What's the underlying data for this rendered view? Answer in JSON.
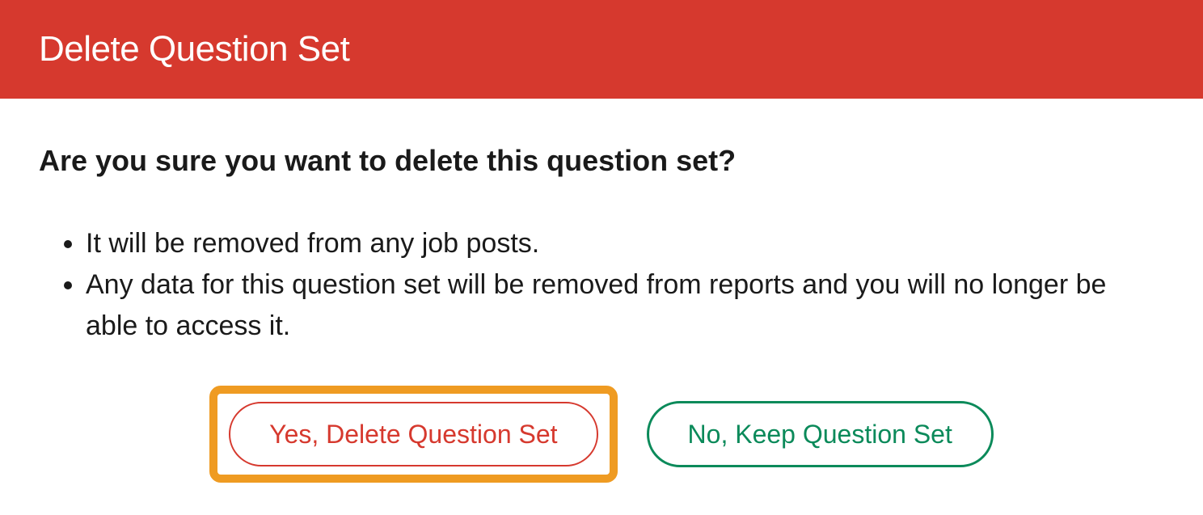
{
  "dialog": {
    "title": "Delete Question Set",
    "confirm_question": "Are you sure you want to delete this question set?",
    "consequences": [
      "It will be removed from any job posts.",
      "Any data for this question set will be removed from reports and you will no longer be able to access it."
    ],
    "actions": {
      "confirm_label": "Yes, Delete Question Set",
      "cancel_label": "No, Keep Question Set"
    }
  }
}
